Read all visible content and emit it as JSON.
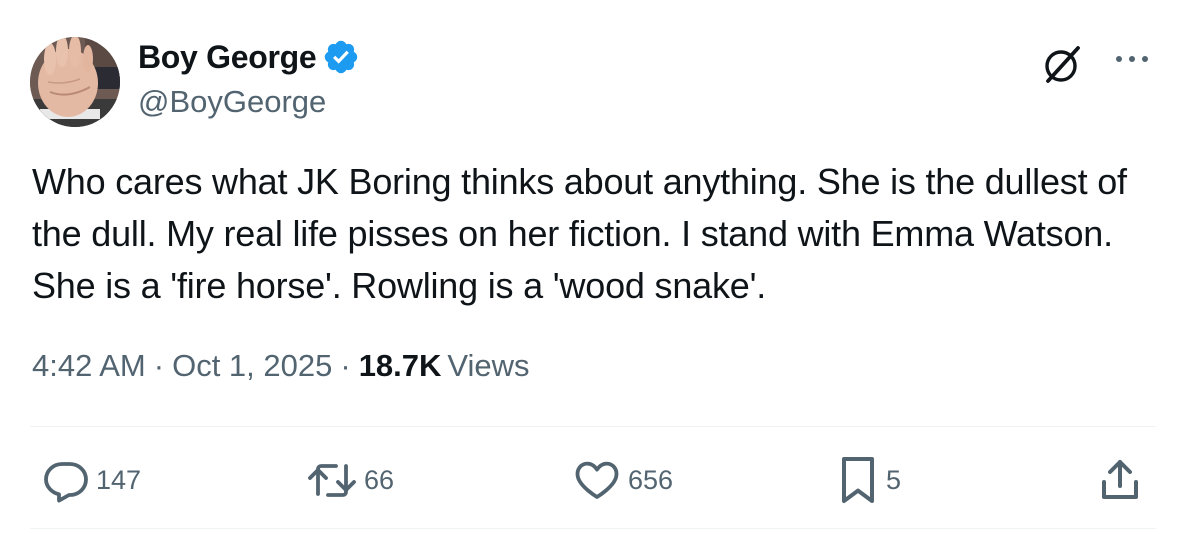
{
  "author": {
    "display_name": "Boy George",
    "handle": "@BoyGeorge",
    "verified": true,
    "verified_color": "#1d9bf0"
  },
  "tweet": {
    "text": "Who cares what JK Boring thinks about anything. She is the dullest of the dull. My real life pisses on her fiction. I stand with Emma Watson. She is a 'fire horse'. Rowling is a 'wood snake'."
  },
  "meta": {
    "time": "4:42 AM",
    "separator": "·",
    "date": "Oct 1, 2025",
    "views_count": "18.7K",
    "views_label": "Views"
  },
  "actions": {
    "replies": "147",
    "reposts": "66",
    "likes": "656",
    "bookmarks": "5"
  },
  "icons": {
    "header": [
      "grok-icon",
      "more-icon"
    ],
    "actions": [
      "reply-icon",
      "repost-icon",
      "like-icon",
      "bookmark-icon",
      "share-icon"
    ]
  },
  "colors": {
    "text_primary": "#0f1419",
    "text_secondary": "#536471",
    "divider": "#eff3f4"
  }
}
